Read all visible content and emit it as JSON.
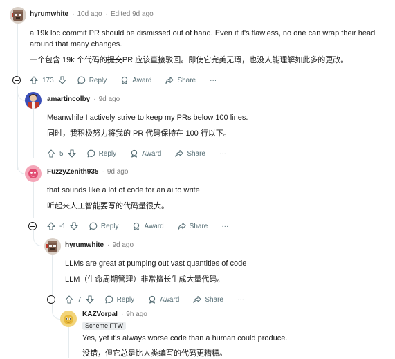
{
  "comments": [
    {
      "author": "hyrumwhite",
      "time": "10d ago",
      "edited": "Edited 9d ago",
      "body_pre": "a 19k loc ",
      "body_strike": "commit",
      "body_post": " PR should be dismissed out of hand. Even if it's flawless, no one can wrap their head around that many changes.",
      "translation_pre": "一个包含 19k 个代码的",
      "translation_strike": "提交",
      "translation_post": "PR 应该直接驳回。即使它完美无瑕，也没人能理解如此多的更改。",
      "score": "173"
    },
    {
      "author": "amartincolby",
      "time": "9d ago",
      "body": "Meanwhile I actively strive to keep my PRs below 100 lines.",
      "translation": "同时，我积极努力将我的 PR 代码保持在 100 行以下。",
      "score": "5"
    },
    {
      "author": "FuzzyZenith935",
      "time": "9d ago",
      "body": "that sounds like a lot of code for an ai to write",
      "translation": "听起来人工智能要写的代码量很大。",
      "score": "-1"
    },
    {
      "author": "hyrumwhite",
      "time": "9d ago",
      "body": "LLMs are great at pumping out vast quantities of code",
      "translation": "LLM（生命周期管理）非常擅长生成大量代码。",
      "score": "7"
    },
    {
      "author": "KAZVorpal",
      "time": "9h ago",
      "flair": "Scheme FTW",
      "body": "Yes, yet it's always worse code than a human could produce.",
      "translation": "没错，但它总是比人类编写的代码更糟糕。"
    }
  ],
  "actions": {
    "reply": "Reply",
    "award": "Award",
    "share": "Share",
    "more": "···"
  },
  "icons": {
    "upvote": "arrow-up-icon",
    "downvote": "arrow-down-icon",
    "reply": "speech-bubble-icon",
    "award": "award-icon",
    "share": "share-arrow-icon",
    "collapse": "minus-circle-icon"
  },
  "colors": {
    "thread_line": "#e5ebee",
    "meta_gray": "#7c7c7c",
    "action_gray": "#576f76"
  }
}
